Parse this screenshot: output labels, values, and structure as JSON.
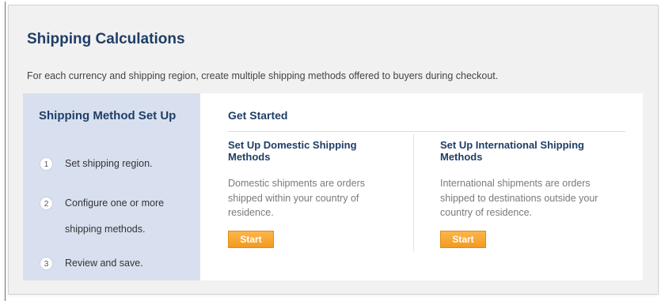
{
  "page": {
    "title": "Shipping Calculations",
    "description": "For each currency and shipping region, create multiple shipping methods offered to buyers during checkout."
  },
  "steps": {
    "title": "Shipping Method Set Up",
    "items": [
      {
        "number": "1",
        "label_line1": "Set shipping region.",
        "label_line2": ""
      },
      {
        "number": "2",
        "label_line1": "Configure one or more",
        "label_line2": "shipping methods."
      },
      {
        "number": "3",
        "label_line1": "Review and save.",
        "label_line2": ""
      }
    ]
  },
  "get_started": {
    "heading": "Get Started",
    "domestic": {
      "title": "Set Up Domestic Shipping Methods",
      "text": "Domestic shipments are orders shipped within your country of residence.",
      "button": "Start"
    },
    "international": {
      "title": "Set Up International Shipping Methods",
      "text": "International shipments are orders shipped to destinations outside your country of residence.",
      "button": "Start"
    }
  },
  "colors": {
    "heading": "#1f3e66",
    "steps_bg": "#d8e0ef",
    "button": "#f6a632"
  }
}
